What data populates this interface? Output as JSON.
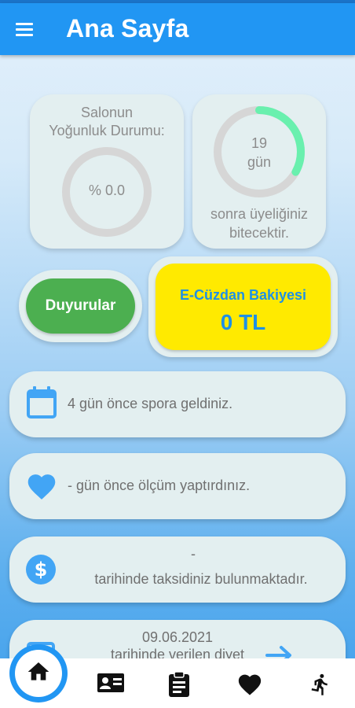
{
  "header": {
    "title": "Ana Sayfa",
    "menu_icon": "hamburger-menu-icon"
  },
  "density": {
    "title_line1": "Salonun",
    "title_line2": "Yoğunluk Durumu:",
    "value": "% 0.0",
    "fraction": 0.0
  },
  "membership": {
    "days": "19",
    "unit": "gün",
    "text_line1": "sonra üyeliğiniz",
    "text_line2": "bitecektir.",
    "progress": 0.33,
    "ring_color": "#69f0ae"
  },
  "announcements": {
    "label": "Duyurular",
    "color": "#4caf50"
  },
  "wallet": {
    "title": "E-Cüzdan Bakiyesi",
    "amount": "0 TL",
    "color": "#ffea00",
    "text_color": "#1e90e6"
  },
  "info_cards": [
    {
      "icon": "calendar-icon",
      "text": "4 gün önce spora geldiniz."
    },
    {
      "icon": "heart-icon",
      "text": "- gün önce ölçüm yaptırdınız."
    },
    {
      "icon": "dollar-icon",
      "line1": "-",
      "line2": "tarihinde taksidiniz bulunmaktadır."
    },
    {
      "icon": "diet-icon",
      "line1": "09.06.2021",
      "line2": "tarihinde verilen diyet",
      "action_icon": "arrow-right-icon"
    }
  ],
  "bottom_nav": [
    {
      "icon": "home-icon",
      "active": true
    },
    {
      "icon": "contact-card-icon"
    },
    {
      "icon": "clipboard-icon"
    },
    {
      "icon": "heart-icon"
    },
    {
      "icon": "running-person-icon"
    }
  ],
  "colors": {
    "primary": "#2196f3",
    "card": "#e3eff0",
    "icon_blue": "#42a5f5",
    "muted_text": "#8c8c8c"
  }
}
